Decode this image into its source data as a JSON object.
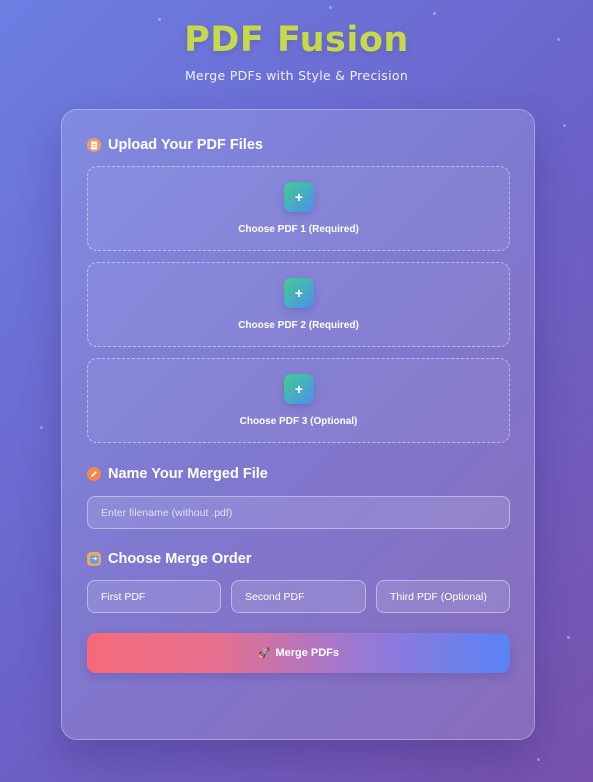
{
  "header": {
    "title": "PDF Fusion",
    "subtitle": "Merge PDFs with Style & Precision"
  },
  "upload_section": {
    "title": "Upload Your PDF Files",
    "icon": "document-icon",
    "slots": [
      {
        "button": "+",
        "label": "Choose PDF 1 (Required)"
      },
      {
        "button": "+",
        "label": "Choose PDF 2 (Required)"
      },
      {
        "button": "+",
        "label": "Choose PDF 3 (Optional)"
      }
    ]
  },
  "name_section": {
    "title": "Name Your Merged File",
    "icon": "pencil-icon",
    "placeholder": "Enter filename (without .pdf)"
  },
  "order_section": {
    "title": "Choose Merge Order",
    "icon": "order-icon",
    "options": [
      {
        "label": "First PDF"
      },
      {
        "label": "Second PDF"
      },
      {
        "label": "Third PDF (Optional)"
      }
    ]
  },
  "merge_button": {
    "label": "Merge PDFs",
    "icon": "rocket-icon"
  },
  "colors": {
    "title": "#c7d84a",
    "accent_green": "#3fcf8e",
    "accent_blue": "#4f8cf0",
    "button_start": "#f56a7a",
    "button_end": "#5a82f5"
  }
}
